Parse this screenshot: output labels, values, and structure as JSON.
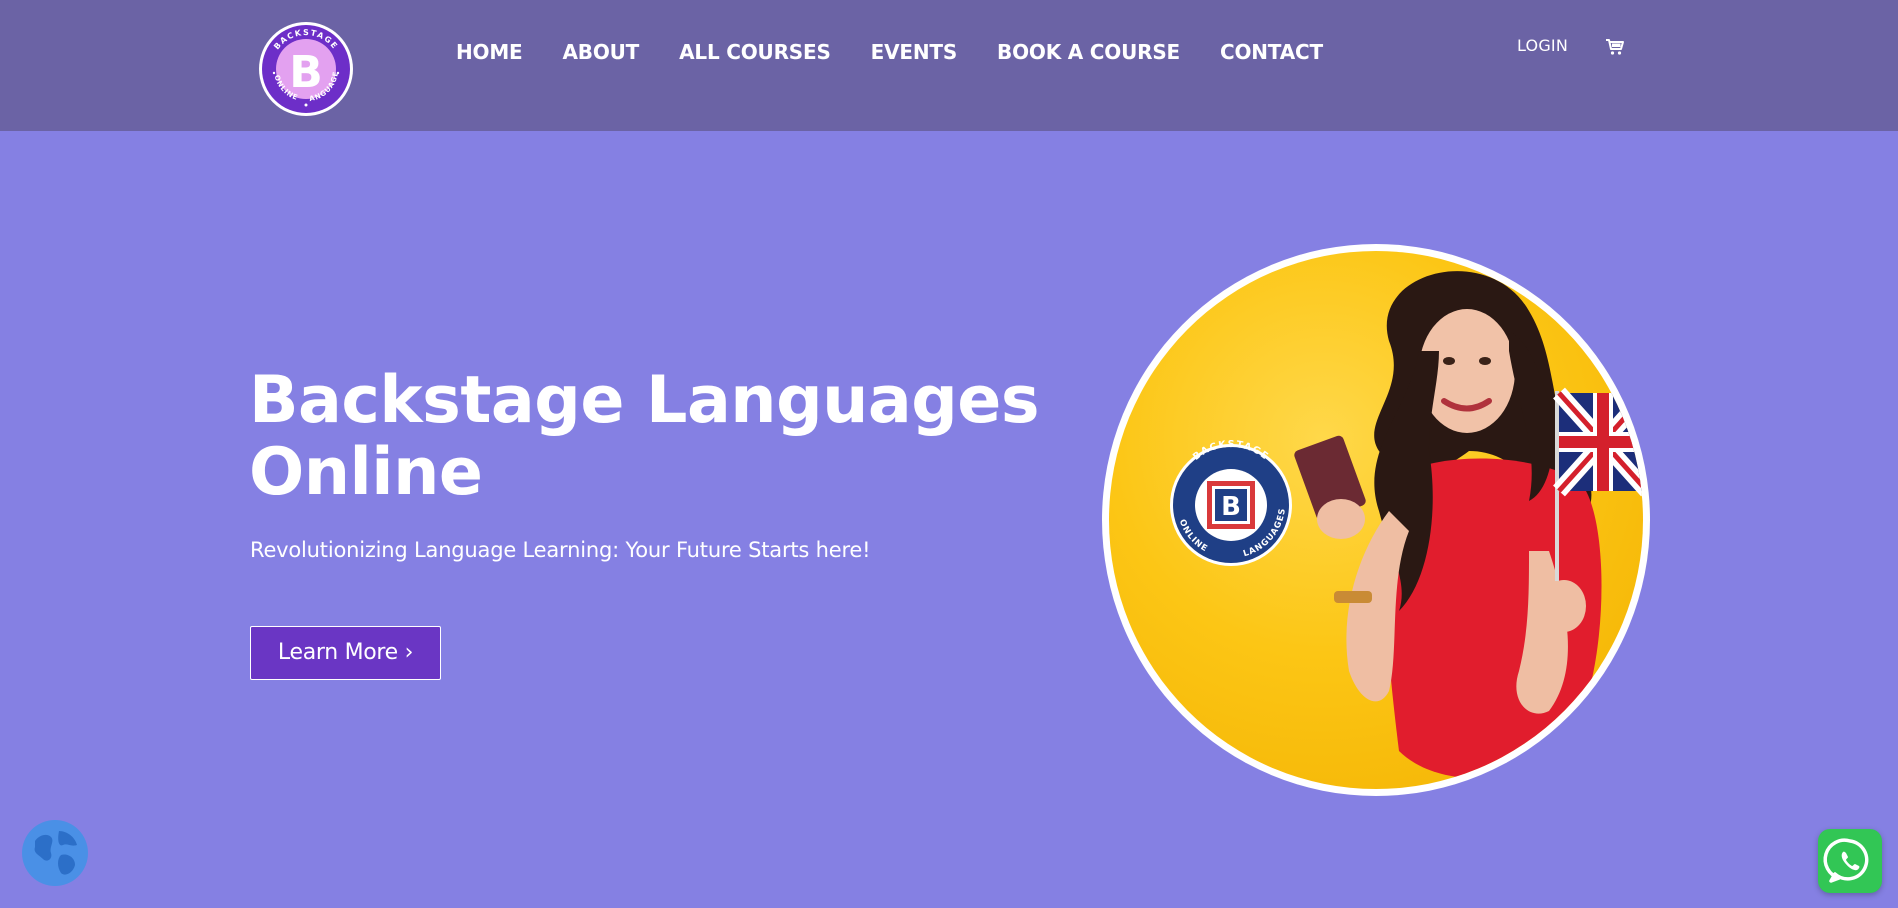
{
  "brand": {
    "logo_top_text": "BACKSTAGE",
    "logo_left_text": "ONLINE",
    "logo_right_text": "LANGUAGES",
    "logo_letter": "B"
  },
  "nav": {
    "items": [
      {
        "label": "HOME"
      },
      {
        "label": "ABOUT"
      },
      {
        "label": "ALL COURSES"
      },
      {
        "label": "EVENTS"
      },
      {
        "label": "BOOK A COURSE"
      },
      {
        "label": "CONTACT"
      }
    ],
    "login_label": "LOGIN",
    "cart_icon": "cart-icon"
  },
  "hero": {
    "title_line1": "Backstage Languages",
    "title_line2": "Online",
    "subtitle": "Revolutionizing Language Learning: Your Future Starts here!",
    "cta_label": "Learn More ›",
    "badge_top_text": "BACKSTAGE",
    "badge_left_text": "ONLINE",
    "badge_right_text": "LANGUAGES",
    "badge_letter": "B"
  },
  "floating": {
    "language_icon": "globe-icon",
    "chat_icon": "whatsapp-icon"
  },
  "colors": {
    "header_bg": "#6b63a5",
    "page_bg": "#8580e3",
    "cta_bg": "#6a36c4",
    "photo_bg": "#fcc615",
    "whatsapp_green": "#32c655"
  }
}
